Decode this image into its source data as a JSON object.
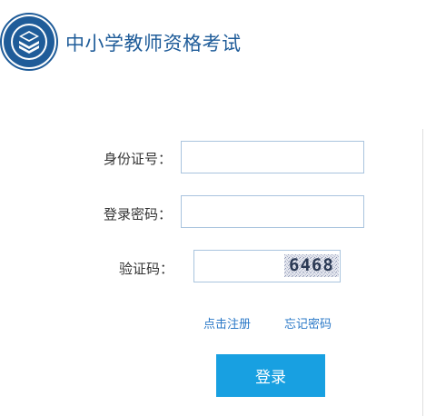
{
  "header": {
    "title": "中小学教师资格考试",
    "logo_icon": "book-emblem-icon",
    "brand_color": "#1f5c99"
  },
  "form": {
    "id_label": "身份证号：",
    "id_value": "",
    "password_label": "登录密码：",
    "password_value": "",
    "captcha_label": "验证码：",
    "captcha_value": "",
    "captcha_image_text": "6468"
  },
  "links": {
    "register": "点击注册",
    "forgot_password": "忘记密码"
  },
  "login_button": "登录",
  "colors": {
    "accent": "#18a0e1",
    "link": "#2a78c7",
    "field_border": "#a9c4de"
  }
}
